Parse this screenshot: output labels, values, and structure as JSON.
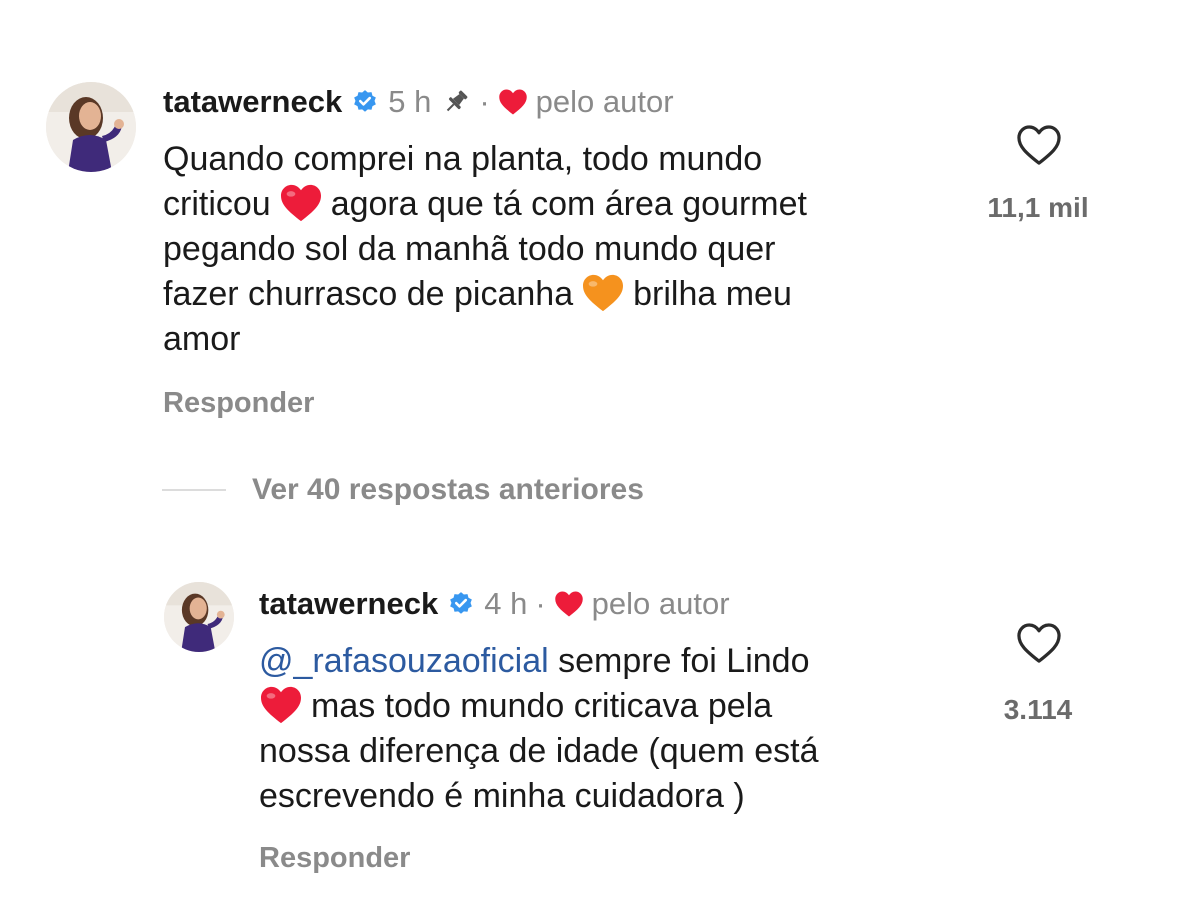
{
  "comments": [
    {
      "username": "tatawerneck",
      "time": "5 h",
      "dot": "·",
      "by_author": "pelo autor",
      "lines": [
        [
          "Quando comprei na planta, todo mundo"
        ],
        [
          "criticou",
          "agora que tá com área gourmet"
        ],
        [
          "pegando sol da manhã todo mundo quer"
        ],
        [
          "fazer churrasco de picanha",
          "brilha meu"
        ],
        [
          "amor"
        ]
      ],
      "likes": "11,1 mil",
      "reply_label": "Responder",
      "pinned": true,
      "icons": [
        "avatar",
        "verified-badge-icon",
        "pin-icon",
        "red-heart-icon",
        "heart-outline-icon",
        "red-heart-emoji",
        "orange-heart-emoji"
      ]
    },
    {
      "username": "tatawerneck",
      "time": "4 h",
      "dot": "·",
      "by_author": "pelo autor",
      "mention": "@_rafasouzaoficial",
      "lines": [
        [
          "sempre foi Lindo"
        ],
        [
          "",
          "mas todo mundo criticava pela"
        ],
        [
          "nossa diferença de idade (quem está"
        ],
        [
          "escrevendo é minha cuidadora )"
        ]
      ],
      "likes": "3.114",
      "reply_label": "Responder",
      "icons": [
        "avatar",
        "verified-badge-icon",
        "red-heart-icon",
        "heart-outline-icon",
        "red-heart-emoji"
      ]
    }
  ],
  "view_previous_replies": "Ver 40 respostas anteriores",
  "colors": {
    "text": "#1a1a1a",
    "muted": "#8a8a8a",
    "verified_blue": "#3897f0",
    "mention": "#2c5aa0",
    "heart_red": "#ed1c3a",
    "emoji_orange": "#f5921e"
  }
}
